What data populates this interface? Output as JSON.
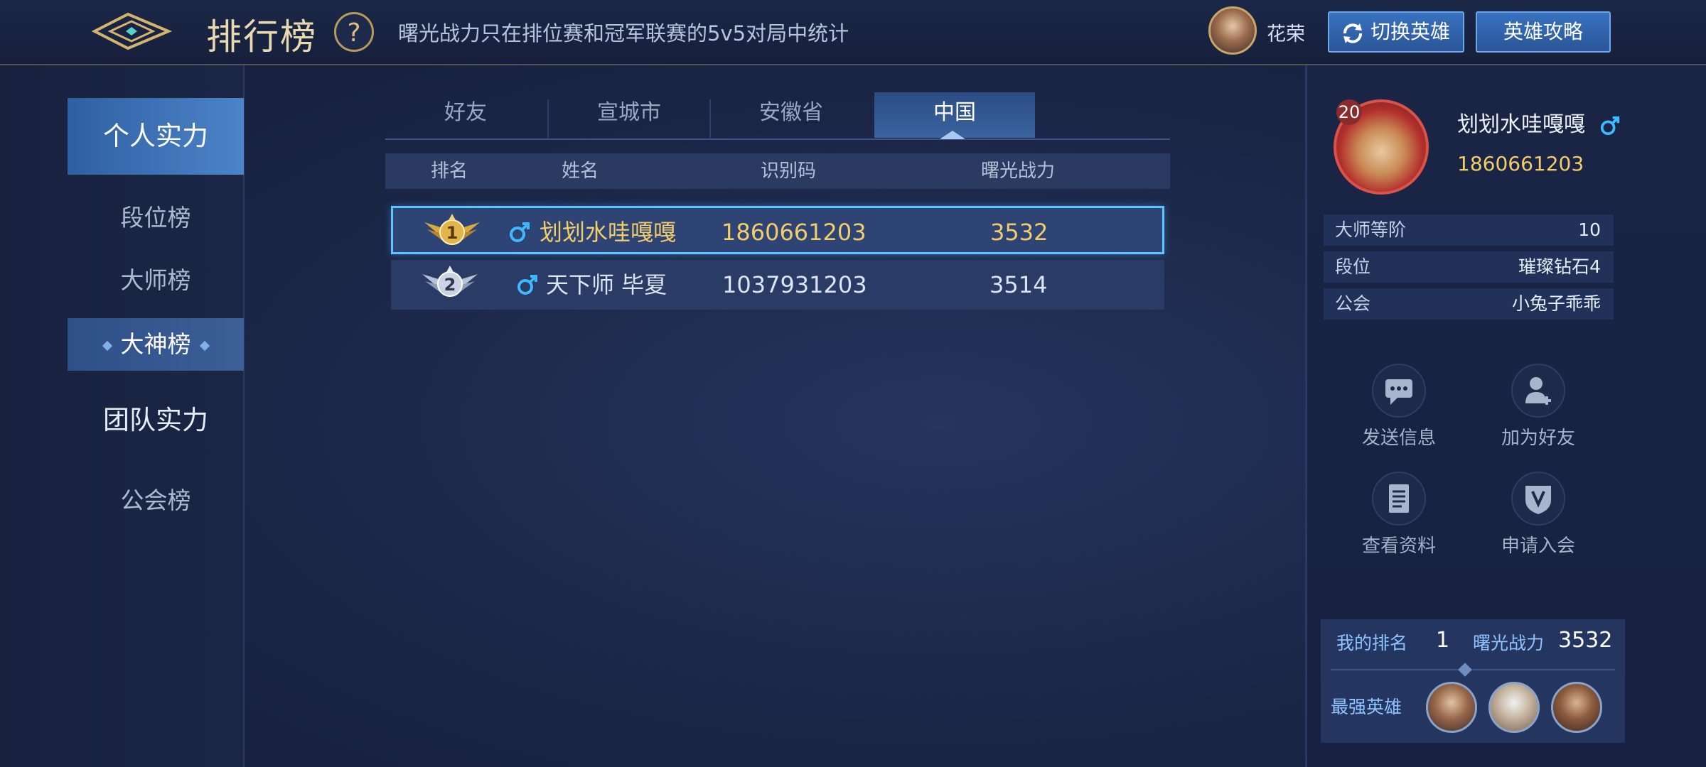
{
  "header": {
    "title": "排行榜",
    "help_label": "?",
    "subtitle": "曙光战力只在排位赛和冠军联赛的5v5对局中统计",
    "hero_name": "花荣",
    "switch_hero_label": "切换英雄",
    "hero_guide_label": "英雄攻略"
  },
  "leftnav": {
    "personal_power": "个人实力",
    "rank_list": "段位榜",
    "master_list": "大师榜",
    "god_list": "大神榜",
    "team_power": "团队实力",
    "guild_list": "公会榜"
  },
  "tabs": [
    "好友",
    "宣城市",
    "安徽省",
    "中国"
  ],
  "table": {
    "headers": [
      "排名",
      "姓名",
      "识别码",
      "曙光战力"
    ],
    "rows": [
      {
        "rank": "1",
        "name": "划划水哇嘎嘎",
        "id": "1860661203",
        "power": "3532"
      },
      {
        "rank": "2",
        "name": "天下师 毕夏",
        "id": "1037931203",
        "power": "3514"
      }
    ]
  },
  "profile": {
    "level": "20",
    "name": "划划水哇嘎嘎",
    "id": "1860661203",
    "stats": [
      {
        "label": "大师等阶",
        "value": "10"
      },
      {
        "label": "段位",
        "value": "璀璨钻石4"
      },
      {
        "label": "公会",
        "value": "小兔子乖乖"
      }
    ],
    "actions": [
      "发送信息",
      "加为好友",
      "查看资料",
      "申请入会"
    ]
  },
  "my_rank": {
    "rank_label": "我的排名",
    "rank_value": "1",
    "power_label": "曙光战力",
    "power_value": "3532",
    "strongest_heroes_label": "最强英雄"
  },
  "colors": {
    "accent_blue": "#4c84c7",
    "gold": "#f2cd6a",
    "highlight_border": "#5fc3ff"
  }
}
